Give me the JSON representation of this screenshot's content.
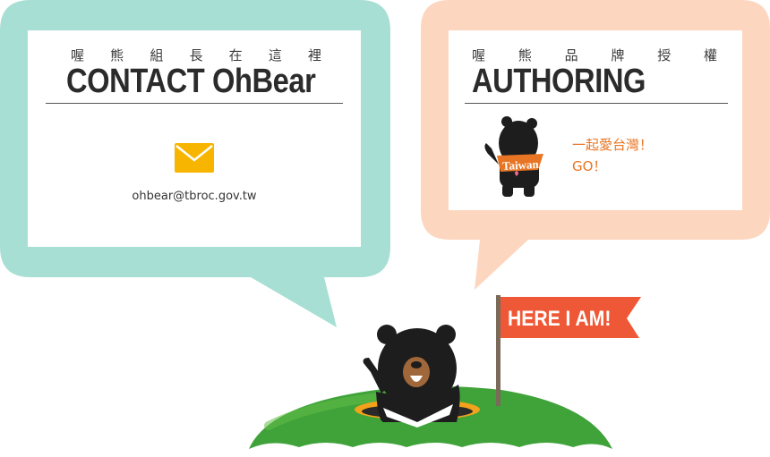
{
  "contact": {
    "subtitle": "喔熊組長在這裡",
    "title": "CONTACT OhBear",
    "email_icon": "envelope-icon",
    "email": "ohbear@tbroc.gov.tw"
  },
  "authoring": {
    "subtitle": "喔熊品牌授權",
    "title": "AUTHORING",
    "mascot_badge": "Taiwan",
    "slogan_line1": "一起愛台灣！",
    "slogan_line2": "GO！"
  },
  "flag": {
    "label": "HERE I AM!"
  },
  "colors": {
    "contact_bubble": "#a8dfd4",
    "authoring_bubble": "#fdd6c0",
    "accent_orange": "#e87524",
    "email_icon": "#f7b500",
    "flag_red": "#ef5836",
    "hill_green": "#3fa33a"
  }
}
